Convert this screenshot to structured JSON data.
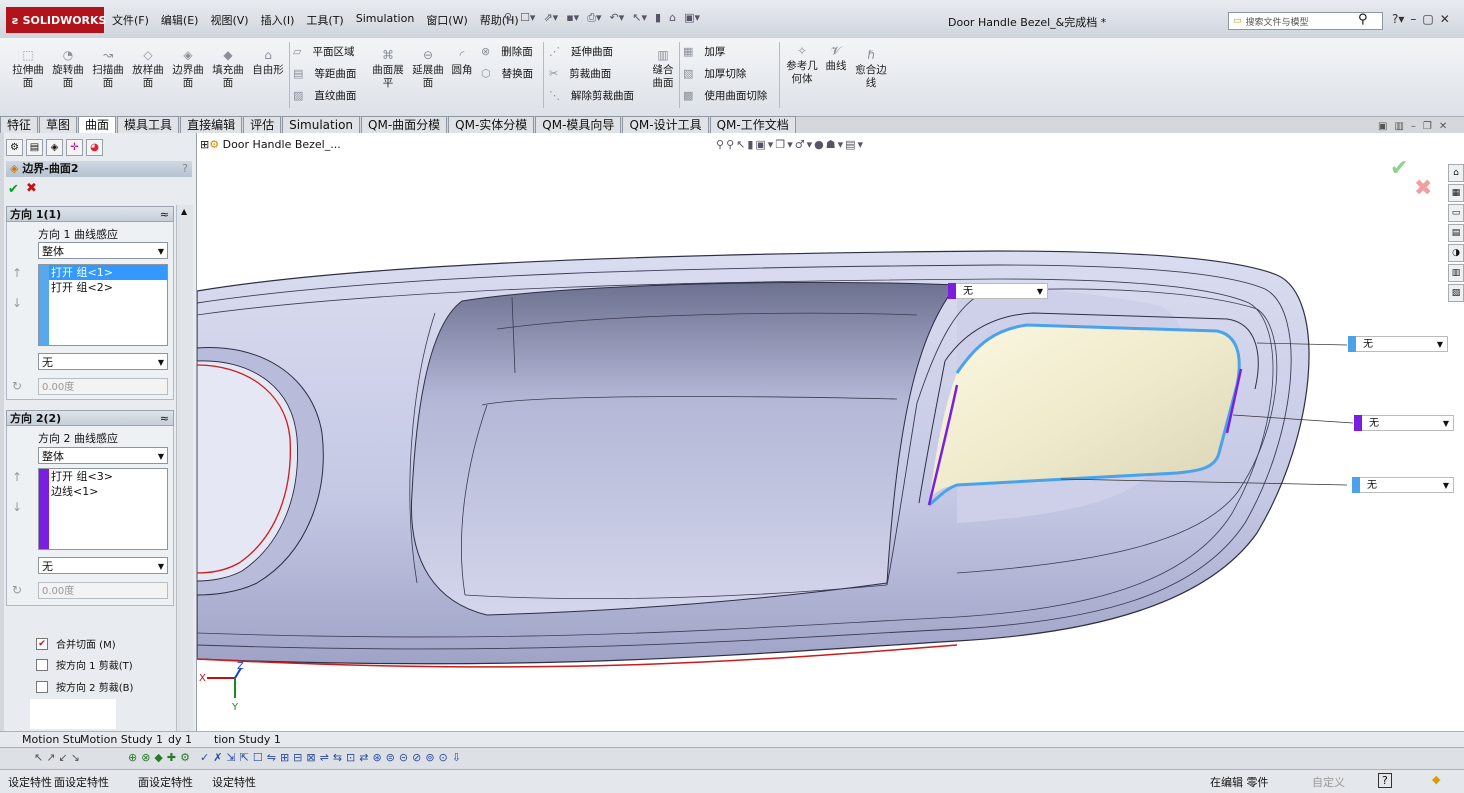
{
  "app": {
    "logo": "SOLIDWORKS",
    "doc_title": "Door Handle Bezel_&完成档 *"
  },
  "menu": [
    "文件(F)",
    "编辑(E)",
    "视图(V)",
    "插入(I)",
    "工具(T)",
    "Simulation",
    "窗口(W)",
    "帮助(H)"
  ],
  "search": {
    "placeholder": "搜索文件与模型"
  },
  "ribbon": {
    "big_buttons": [
      {
        "l1": "拉伸曲",
        "l2": "面",
        "icon": "extrude-surface-icon"
      },
      {
        "l1": "旋转曲",
        "l2": "面",
        "icon": "revolve-surface-icon"
      },
      {
        "l1": "扫描曲",
        "l2": "面",
        "icon": "sweep-surface-icon"
      },
      {
        "l1": "放样曲",
        "l2": "面",
        "icon": "loft-surface-icon"
      },
      {
        "l1": "边界曲",
        "l2": "面",
        "icon": "boundary-surface-icon"
      },
      {
        "l1": "填充曲",
        "l2": "面",
        "icon": "fill-surface-icon"
      },
      {
        "l1": "自由形",
        "l2": "",
        "icon": "freeform-icon"
      }
    ],
    "col1": [
      "平面区域",
      "等距曲面",
      "直纹曲面"
    ],
    "mid_buttons": [
      {
        "l1": "曲面展",
        "l2": "平"
      },
      {
        "l1": "延展曲",
        "l2": "面"
      },
      {
        "l1": "圆角",
        "l2": ""
      }
    ],
    "col2": [
      "删除面",
      "替换面"
    ],
    "col3": [
      "延伸曲面",
      "剪裁曲面",
      "解除剪裁曲面"
    ],
    "knit": {
      "l1": "缝合",
      "l2": "曲面"
    },
    "col4": [
      "加厚",
      "加厚切除",
      "使用曲面切除"
    ],
    "ref": {
      "l1": "参考几",
      "l2": "何体"
    },
    "curves": {
      "l1": "曲线"
    },
    "composite": {
      "l1": "愈合边",
      "l2": "线"
    }
  },
  "tabs": [
    "特征",
    "草图",
    "曲面",
    "模具工具",
    "直接编辑",
    "评估",
    "Simulation",
    "QM-曲面分模",
    "QM-实体分模",
    "QM-模具向导",
    "QM-设计工具",
    "QM-工作文档"
  ],
  "active_tab": "曲面",
  "property_manager": {
    "title": "边界-曲面2",
    "dir1": {
      "header": "方向 1(1)",
      "label": "方向 1 曲线感应",
      "influence": "整体",
      "items": [
        "打开 组<1>",
        "打开 组<2>"
      ],
      "tangent": "无",
      "angle": "0.00度"
    },
    "dir2": {
      "header": "方向 2(2)",
      "label": "方向 2 曲线感应",
      "influence": "整体",
      "items": [
        "打开 组<3>",
        "边线<1>"
      ],
      "tangent": "无",
      "angle": "0.00度"
    },
    "options": [
      "合并切面 (M)",
      "按方向 1 剪裁(T)",
      "按方向 2 剪裁(B)"
    ],
    "options_checked": [
      true,
      false,
      false
    ]
  },
  "viewport": {
    "tree_label": "Door Handle Bezel_...",
    "tags": [
      "无",
      "无",
      "无",
      "无"
    ],
    "triad": {
      "x": "X",
      "y": "Y",
      "z": "Z"
    }
  },
  "motion_tabs": [
    "Motion Stu",
    "Motion Study 1",
    "dy 1",
    "tion Study 1"
  ],
  "status": {
    "left": [
      "设定特性",
      "面设定特性",
      "面设定特性",
      "设定特性"
    ],
    "editing": "在编辑 零件",
    "custom": "自定义",
    "help": "?"
  },
  "colors": {
    "accent_blue": "#3399ff",
    "purple": "#7a1fe0",
    "model": "#c9cce6",
    "face_yellow": "#f4f1d4"
  }
}
